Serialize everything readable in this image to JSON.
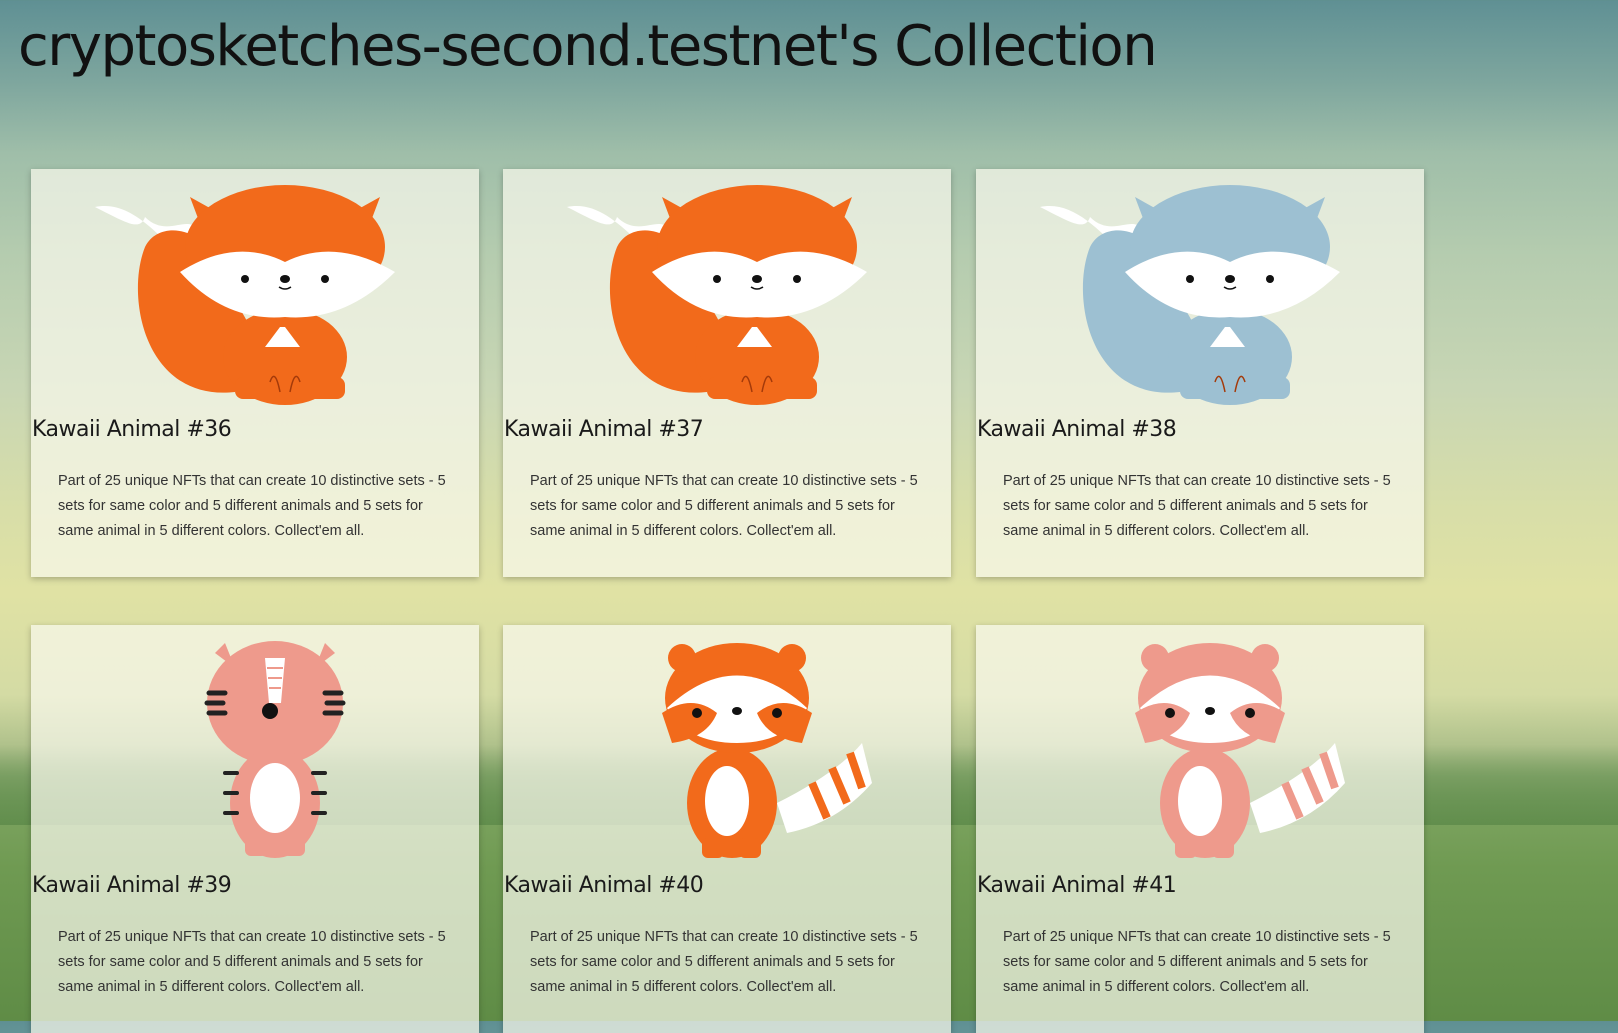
{
  "page": {
    "title": "cryptosketches-second.testnet's Collection"
  },
  "description": "Part of 25 unique NFTs that can create 10 distinctive sets - 5 sets for same color and 5 different animals and 5 sets for same animal in 5 different colors. Collect'em all.",
  "cards": [
    {
      "name": "Kawaii Animal #36",
      "animal": "fox",
      "color": "#f26a1b"
    },
    {
      "name": "Kawaii Animal #37",
      "animal": "fox",
      "color": "#f26a1b"
    },
    {
      "name": "Kawaii Animal #38",
      "animal": "fox",
      "color": "#9dc0d2"
    },
    {
      "name": "Kawaii Animal #39",
      "animal": "tiger",
      "color": "#ee9a8c"
    },
    {
      "name": "Kawaii Animal #40",
      "animal": "raccoon",
      "color": "#f26a1b"
    },
    {
      "name": "Kawaii Animal #41",
      "animal": "raccoon",
      "color": "#ee9a8c"
    }
  ]
}
